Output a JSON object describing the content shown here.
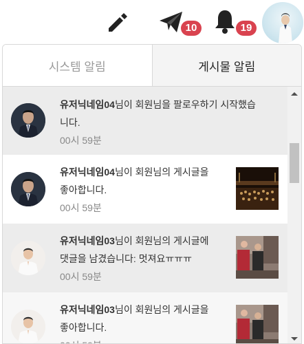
{
  "header": {
    "icons": [
      "pencil-icon",
      "paper-plane-icon",
      "bell-icon"
    ],
    "message_badge": "10",
    "notification_badge": "19",
    "badge_color": "#d9434f"
  },
  "tabs": [
    {
      "label": "시스템 알림",
      "active": false
    },
    {
      "label": "게시물 알림",
      "active": true
    }
  ],
  "notifications": [
    {
      "user": "유저닉네임04",
      "line1_rest": "님이 회원님을 팔로우하기 시작했습",
      "line2": "니다.",
      "time": "00시 59분",
      "thumbnail": ""
    },
    {
      "user": "유저닉네임04",
      "line1_rest": "님이 회원님의 게시글을",
      "line2": "좋아합니다.",
      "time": "00시 59분",
      "thumbnail": "concert-photo"
    },
    {
      "user": "유저닉네임03",
      "line1_rest": "님이 회원님의 게시글에",
      "line2": "댓글을 남겼습니다: 멋져요ㅠㅠㅠ",
      "time": "00시 59분",
      "thumbnail": "street-photo"
    },
    {
      "user": "유저닉네임03",
      "line1_rest": "님이 회원님의 게시글을",
      "line2": "좋아합니다.",
      "time": "00시 59분",
      "thumbnail": "street-photo"
    }
  ]
}
